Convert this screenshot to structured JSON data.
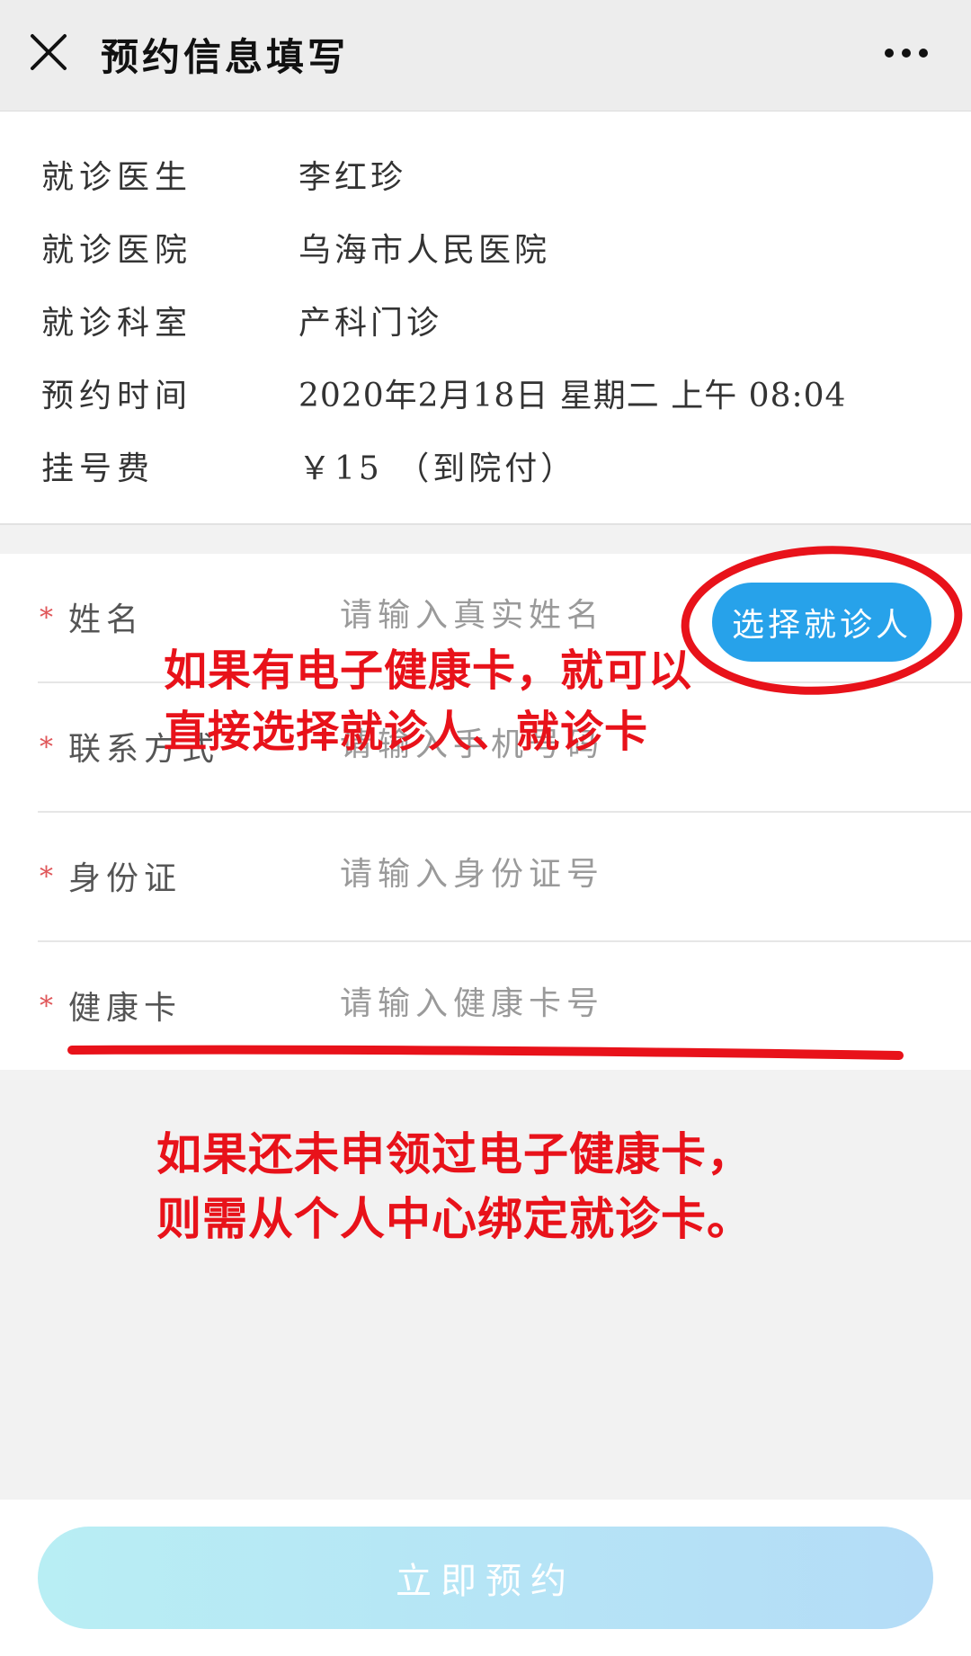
{
  "header": {
    "title": "预约信息填写",
    "close_icon": "close-icon",
    "more_icon": "more-icon"
  },
  "appointment_info": [
    {
      "label": "就诊医生",
      "value": "李红珍"
    },
    {
      "label": "就诊医院",
      "value": "乌海市人民医院"
    },
    {
      "label": "就诊科室",
      "value": "产科门诊"
    },
    {
      "label": "预约时间",
      "value": "2020年2月18日 星期二 上午 08:04"
    },
    {
      "label": "挂号费",
      "value": "￥15 （到院付）"
    }
  ],
  "form": {
    "required_mark": "*",
    "fields": [
      {
        "label": "姓名",
        "placeholder": "请输入真实姓名",
        "value": ""
      },
      {
        "label": "联系方式",
        "placeholder": "请输入手机号码",
        "value": ""
      },
      {
        "label": "身份证",
        "placeholder": "请输入身份证号",
        "value": ""
      },
      {
        "label": "健康卡",
        "placeholder": "请输入健康卡号",
        "value": ""
      }
    ],
    "choose_patient_label": "选择就诊人"
  },
  "annotations": {
    "note1_line1": "如果有电子健康卡，就可以",
    "note1_line2": "直接选择就诊人、就诊卡",
    "note2_line1": "如果还未申领过电子健康卡，",
    "note2_line2": "则需从个人中心绑定就诊卡。",
    "annotation_color": "#e8121a"
  },
  "submit": {
    "label": "立即预约"
  }
}
